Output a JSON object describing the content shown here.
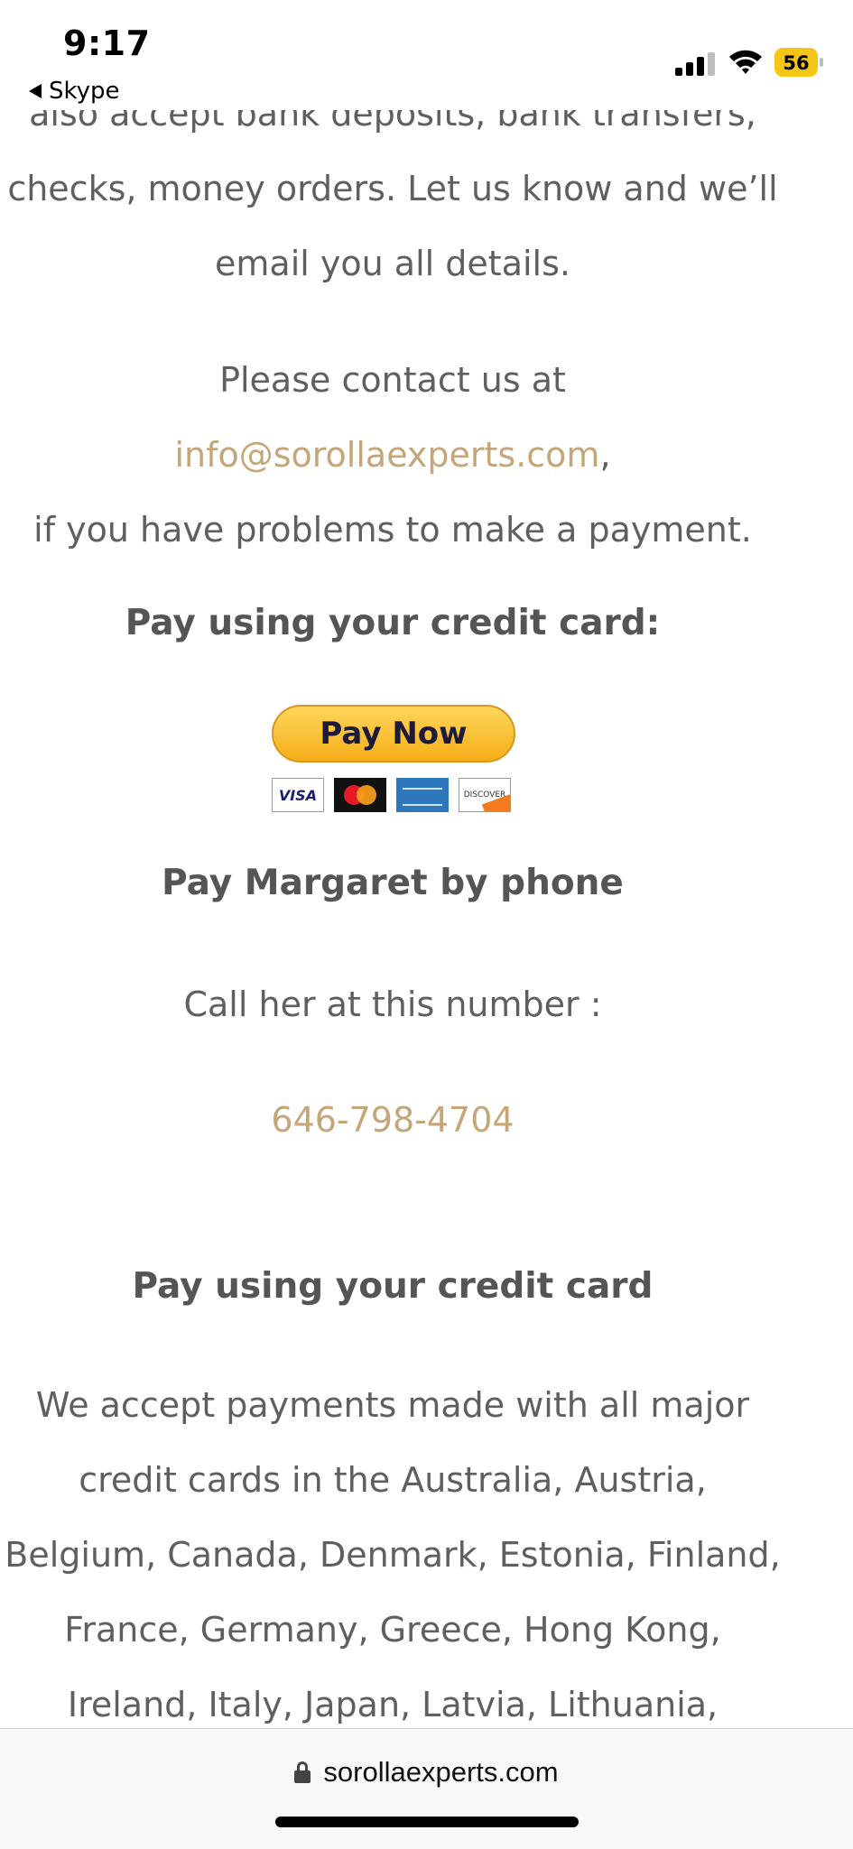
{
  "status_bar": {
    "time": "9:17",
    "back_app": "Skype",
    "battery": "56",
    "battery_color": "#f5c518"
  },
  "content": {
    "top_paragraph_lines": [
      "also accept bank deposits, bank transfers,",
      "checks, money orders. Let us know and we’ll",
      "email you all details."
    ],
    "contact_prefix": "Please contact us at ",
    "contact_email": "info@sorollaexperts.com",
    "contact_comma": ",",
    "contact_line2": "if you have problems to make a payment.",
    "credit_heading_1": "Pay using your credit card:",
    "pay_now_label": "Pay Now",
    "card_logos": [
      "VISA",
      "Mastercard",
      "American Express",
      "DISCOVER"
    ],
    "phone_heading": "Pay Margaret by phone",
    "call_text": "Call her at this number :",
    "phone_number": "646-798-4704",
    "credit_heading_2": "Pay using your credit card",
    "accept_lines": [
      "We accept payments made with all major",
      "credit cards in the Australia, Austria,",
      "Belgium, Canada, Denmark, Estonia, Finland,",
      "France, Germany, Greece, Hong Kong,",
      "Ireland, Italy, Japan, Latvia, Lithuania,"
    ],
    "link_color": "#c4a679"
  },
  "url_bar": {
    "url": "sorollaexperts.com"
  }
}
